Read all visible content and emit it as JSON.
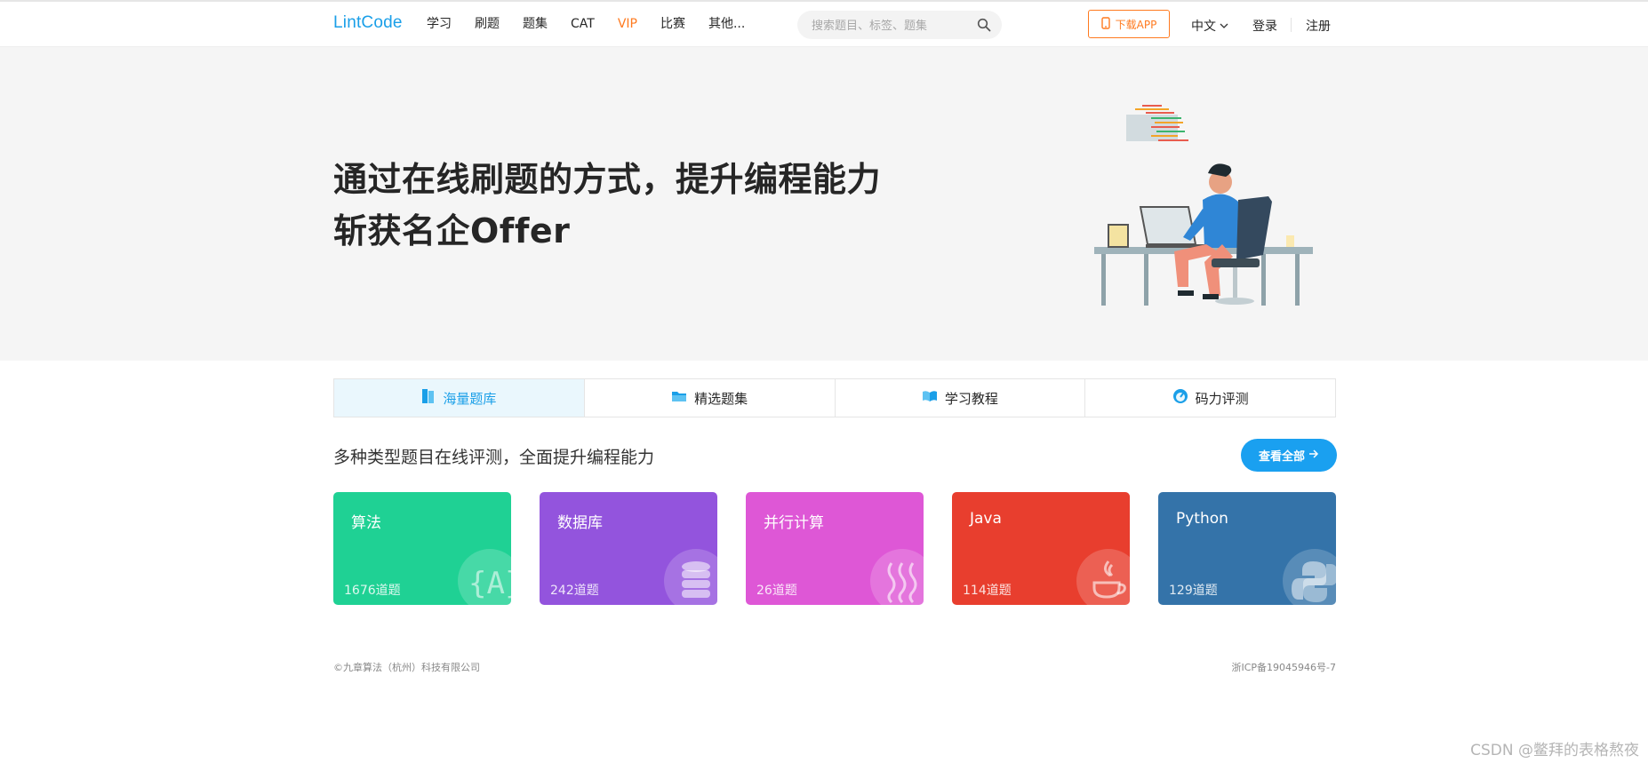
{
  "nav": {
    "logo": "LintCode",
    "links": [
      "学习",
      "刷题",
      "题集",
      "CAT",
      "VIP",
      "比赛",
      "其他..."
    ],
    "search_placeholder": "搜索题目、标签、题集",
    "download_label": "下载APP",
    "lang_label": "中文",
    "login_label": "登录",
    "register_label": "注册",
    "accent_color": "#1a9fe8",
    "vip_color": "#ff7a1f"
  },
  "hero": {
    "line1": "通过在线刷题的方式，提升编程能力",
    "line2": "斩获名企Offer"
  },
  "tabs": [
    {
      "label": "海量题库",
      "icon": "book-icon",
      "active": true
    },
    {
      "label": "精选题集",
      "icon": "folder-icon",
      "active": false
    },
    {
      "label": "学习教程",
      "icon": "open-book-icon",
      "active": false
    },
    {
      "label": "码力评测",
      "icon": "gauge-icon",
      "active": false
    }
  ],
  "section": {
    "subtitle": "多种类型题目在线评测，全面提升编程能力",
    "view_all": "查看全部"
  },
  "cards": [
    {
      "name": "算法",
      "count": "1676道题",
      "color": "#1fd194",
      "icon": "algorithm-icon"
    },
    {
      "name": "数据库",
      "count": "242道题",
      "color": "#9354dd",
      "icon": "database-icon"
    },
    {
      "name": "并行计算",
      "count": "26道题",
      "color": "#de57d6",
      "icon": "parallel-icon"
    },
    {
      "name": "Java",
      "count": "114道题",
      "color": "#e83e2e",
      "icon": "java-icon"
    },
    {
      "name": "Python",
      "count": "129道题",
      "color": "#3473a9",
      "icon": "python-icon"
    }
  ],
  "footer": {
    "copyright": "©九章算法（杭州）科技有限公司",
    "icp": "浙ICP备19045946号-7"
  },
  "watermark": "CSDN @鳖拜的表格熬夜"
}
